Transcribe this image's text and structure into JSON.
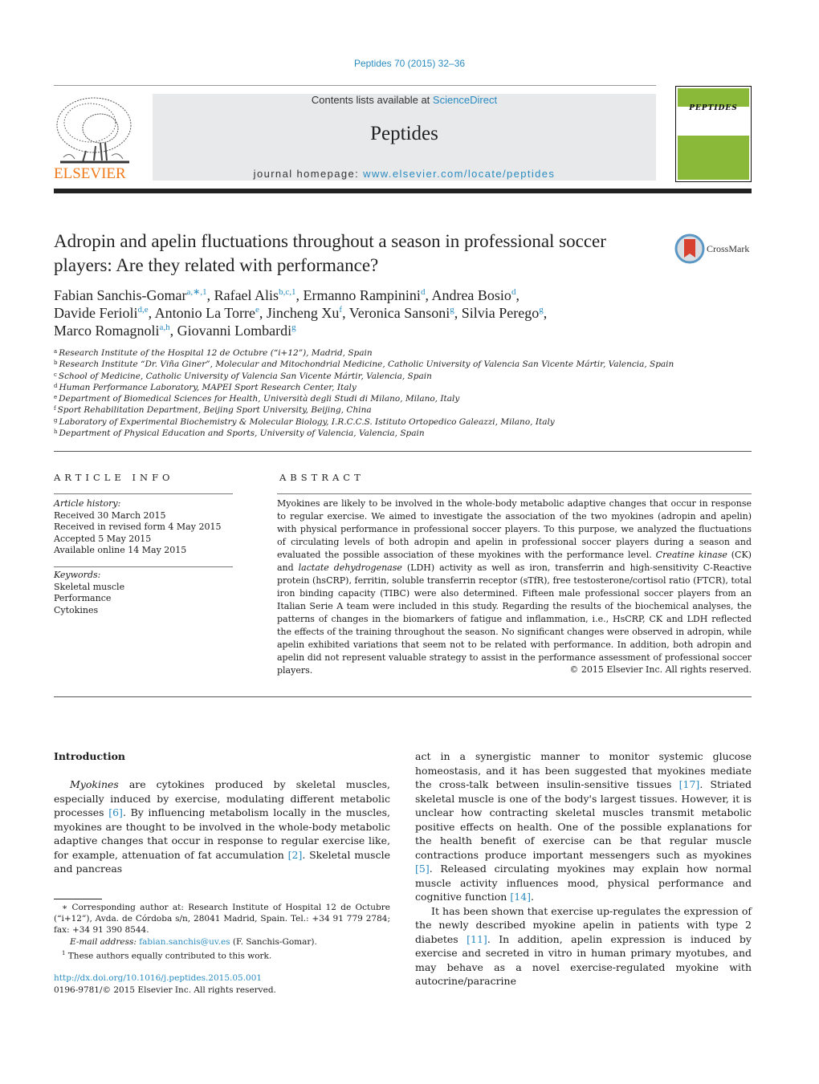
{
  "header": {
    "journal_ref": "Peptides 70 (2015) 32–36",
    "contents_prefix": "Contents lists available at ",
    "contents_link": "ScienceDirect",
    "journal_name": "Peptides",
    "homepage_prefix": "journal homepage: ",
    "homepage_link": "www.elsevier.com/locate/peptides",
    "publisher_logo": "ELSEVIER",
    "cover_title": "PEPTIDES",
    "crossmark_label": "CrossMark",
    "colors": {
      "link": "#2a8bc0",
      "elsevier_orange": "#f07a1a",
      "cover_green": "#8ab93a"
    }
  },
  "article": {
    "title": "Adropin and apelin fluctuations throughout a season in professional soccer players: Are they related with performance?",
    "authors": [
      {
        "name": "Fabian Sanchis-Gomar",
        "sup": "a,∗,1"
      },
      {
        "name": "Rafael Alis",
        "sup": "b,c,1"
      },
      {
        "name": "Ermanno Rampinini",
        "sup": "d"
      },
      {
        "name": "Andrea Bosio",
        "sup": "d"
      },
      {
        "name": "Davide Ferioli",
        "sup": "d,e"
      },
      {
        "name": "Antonio La Torre",
        "sup": "e"
      },
      {
        "name": "Jincheng Xu",
        "sup": "f"
      },
      {
        "name": "Veronica Sansoni",
        "sup": "g"
      },
      {
        "name": "Silvia Perego",
        "sup": "g"
      },
      {
        "name": "Marco Romagnoli",
        "sup": "a,h"
      },
      {
        "name": "Giovanni Lombardi",
        "sup": "g"
      }
    ],
    "affiliations": [
      {
        "key": "a",
        "text": "Research Institute of the Hospital 12 de Octubre (“i+12”), Madrid, Spain"
      },
      {
        "key": "b",
        "text": "Research Institute “Dr. Viña Giner”, Molecular and Mitochondrial Medicine, Catholic University of Valencia San Vicente Mártir, Valencia, Spain"
      },
      {
        "key": "c",
        "text": "School of Medicine, Catholic University of Valencia San Vicente Mártir, Valencia, Spain"
      },
      {
        "key": "d",
        "text": "Human Performance Laboratory, MAPEI Sport Research Center, Italy"
      },
      {
        "key": "e",
        "text": "Department of Biomedical Sciences for Health, Università degli Studi di Milano, Milano, Italy"
      },
      {
        "key": "f",
        "text": "Sport Rehabilitation Department, Beijing Sport University, Beijing, China"
      },
      {
        "key": "g",
        "text": "Laboratory of Experimental Biochemistry & Molecular Biology, I.R.C.C.S. Istituto Ortopedico Galeazzi, Milano, Italy"
      },
      {
        "key": "h",
        "text": "Department of Physical Education and Sports, University of Valencia, Valencia, Spain"
      }
    ]
  },
  "article_info": {
    "heading": "ARTICLE INFO",
    "history_label": "Article history:",
    "history": [
      "Received 30 March 2015",
      "Received in revised form 4 May 2015",
      "Accepted 5 May 2015",
      "Available online 14 May 2015"
    ],
    "keywords_label": "Keywords:",
    "keywords": [
      "Skeletal muscle",
      "Performance",
      "Cytokines"
    ]
  },
  "abstract": {
    "heading": "ABSTRACT",
    "p1": "Myokines are likely to be involved in the whole-body metabolic adaptive changes that occur in response to regular exercise. We aimed to investigate the association of the two myokines (adropin and apelin) with physical performance in professional soccer players. To this purpose, we analyzed the fluctuations of circulating levels of both adropin and apelin in professional soccer players during a season and evaluated the possible association of these myokines with the performance level. ",
    "em1": "Creatine kinase",
    "p2": " (CK) and ",
    "em2": "lactate dehydrogenase",
    "p3": " (LDH) activity as well as iron, transferrin and high-sensitivity C-Reactive protein (hsCRP), ferritin, soluble transferrin receptor (sTfR), free testosterone/cortisol ratio (FTCR), total iron binding capacity (TIBC) were also determined. Fifteen male professional soccer players from an Italian Serie A team were included in this study. Regarding the results of the biochemical analyses, the patterns of changes in the biomarkers of fatigue and inflammation, i.e., HsCRP, CK and LDH reflected the effects of the training throughout the season. No significant changes were observed in adropin, while apelin exhibited variations that seem not to be related with performance. In addition, both adropin and apelin did not represent valuable strategy to assist in the performance assessment of professional soccer players.",
    "copyright": "© 2015 Elsevier Inc. All rights reserved."
  },
  "body": {
    "intro_heading": "Introduction",
    "left": {
      "em": "Myokines",
      "t1": " are cytokines produced by skeletal muscles, especially induced by exercise, modulating different metabolic processes ",
      "r1": "[6]",
      "t2": ". By influencing metabolism locally in the muscles, myokines are thought to be involved in the whole-body metabolic adaptive changes that occur in response to regular exercise like, for example, attenuation of fat accumulation ",
      "r2": "[2]",
      "t3": ". Skeletal muscle and pancreas"
    },
    "right": {
      "t1": "act in a synergistic manner to monitor systemic glucose homeostasis, and it has been suggested that myokines mediate the cross-talk between insulin-sensitive tissues ",
      "r1": "[17]",
      "t2": ". Striated skeletal muscle is one of the body's largest tissues. However, it is unclear how contracting skeletal muscles transmit metabolic positive effects on health. One of the possible explanations for the health benefit of exercise can be that regular muscle contractions produce important messengers such as myokines ",
      "r2": "[5]",
      "t3": ". Released circulating myokines may explain how normal muscle activity influences mood, physical performance and cognitive function ",
      "r3": "[14]",
      "t4": ".",
      "p2_t1": "It has been shown that exercise up-regulates the expression of the newly described myokine apelin in patients with type 2 diabetes ",
      "p2_r1": "[11]",
      "p2_t2": ". In addition, apelin expression is induced by exercise and secreted in vitro in human primary myotubes, and may behave as a novel exercise-regulated myokine with autocrine/paracrine"
    }
  },
  "footnotes": {
    "corr_mark": "∗",
    "corr_text": " Corresponding author at: Research Institute of Hospital 12 de Octubre (“i+12”), Avda. de Córdoba s/n, 28041 Madrid, Spain. Tel.: +34 91 779 2784; fax: +34 91 390 8544.",
    "email_label": "E-mail address: ",
    "email": "fabian.sanchis@uv.es",
    "email_suffix": " (F. Sanchis-Gomar).",
    "equal_mark": "1",
    "equal_text": " These authors equally contributed to this work.",
    "doi": "http://dx.doi.org/10.1016/j.peptides.2015.05.001",
    "issn": "0196-9781/© 2015 Elsevier Inc. All rights reserved."
  }
}
